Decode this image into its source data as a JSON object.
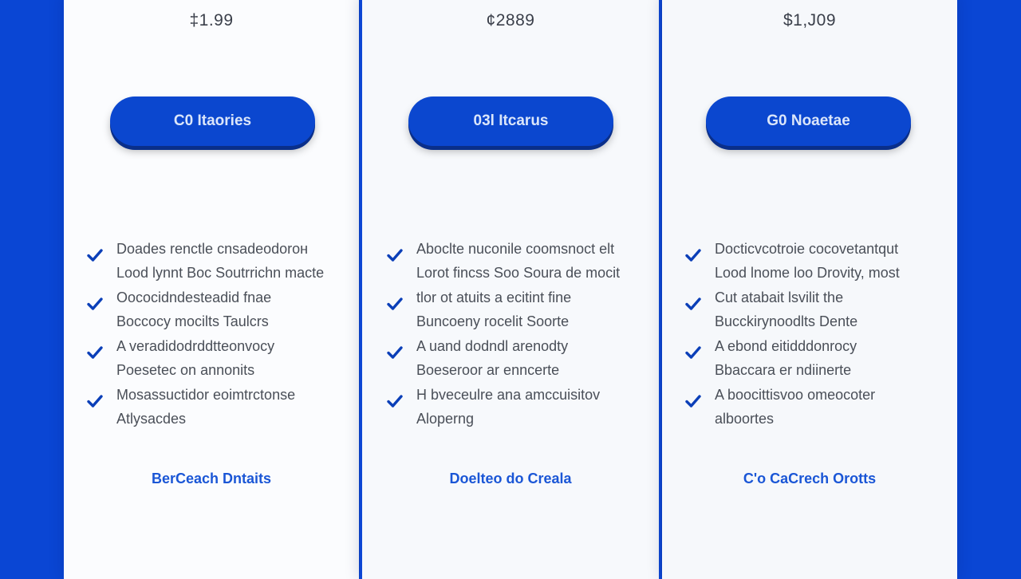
{
  "colors": {
    "background": "#0a46d4",
    "card": "#f9fbfd",
    "accent": "#0b47cf",
    "link": "#1a56d6",
    "check": "#0b3fb8",
    "text": "#4a4f58"
  },
  "plans": [
    {
      "price": "‡1.99",
      "cta_label": "C0 Itaories",
      "features": [
        {
          "icon": "check-icon",
          "lines": [
            "Doades renctle cnsadeodorон",
            "Lood lynnt Boc Soutrrichn macte"
          ]
        },
        {
          "icon": "check-icon",
          "lines": [
            "Oococidndesteadid fnae",
            "Boccocy mocilts Taulcrs"
          ]
        },
        {
          "icon": "check-icon",
          "lines": [
            "A veradidodrddtteonvocy",
            "Poesetec on annonits"
          ]
        },
        {
          "icon": "check-icon",
          "lines": [
            "Mosassuctidor eoimtrctonse",
            "Atlysacdes"
          ]
        }
      ],
      "details_label": "BerCeach Dntaits"
    },
    {
      "price": "¢2889",
      "cta_label": "03l Itcarus",
      "features": [
        {
          "icon": "check-icon",
          "lines": [
            "Aboclte nuconile coomsnoct elt",
            "Lorot fincss Soo Soura de mocit"
          ]
        },
        {
          "icon": "check-icon",
          "lines": [
            "tlor ot atuits a ecitint fine",
            "Buncoeny rocelit Soorte"
          ]
        },
        {
          "icon": "check-icon",
          "lines": [
            "A uand dodndl arenodty",
            "Boeseroor ar enncerte"
          ]
        },
        {
          "icon": "check-icon",
          "lines": [
            "H bveceulre ana amccuisitov",
            "Aloperng"
          ]
        }
      ],
      "details_label": "Doelteo do Creala"
    },
    {
      "price": "$1,J09",
      "cta_label": "G0 Noaetae",
      "features": [
        {
          "icon": "check-icon",
          "lines": [
            "Docticvcotroie cocovetantqut",
            "Lood lnome loo Drovity, most"
          ]
        },
        {
          "icon": "check-icon",
          "lines": [
            "Cut atabait lsvilit the",
            "Bucckirynoodlts Dente"
          ]
        },
        {
          "icon": "check-icon",
          "lines": [
            "A ebond eitidddonrocy",
            "Bbaccara er ndiinerte"
          ]
        },
        {
          "icon": "check-icon",
          "lines": [
            "A boocittisvoo omeocoter",
            "alboortes"
          ]
        }
      ],
      "details_label": "C'o CaCrech Orotts"
    }
  ]
}
